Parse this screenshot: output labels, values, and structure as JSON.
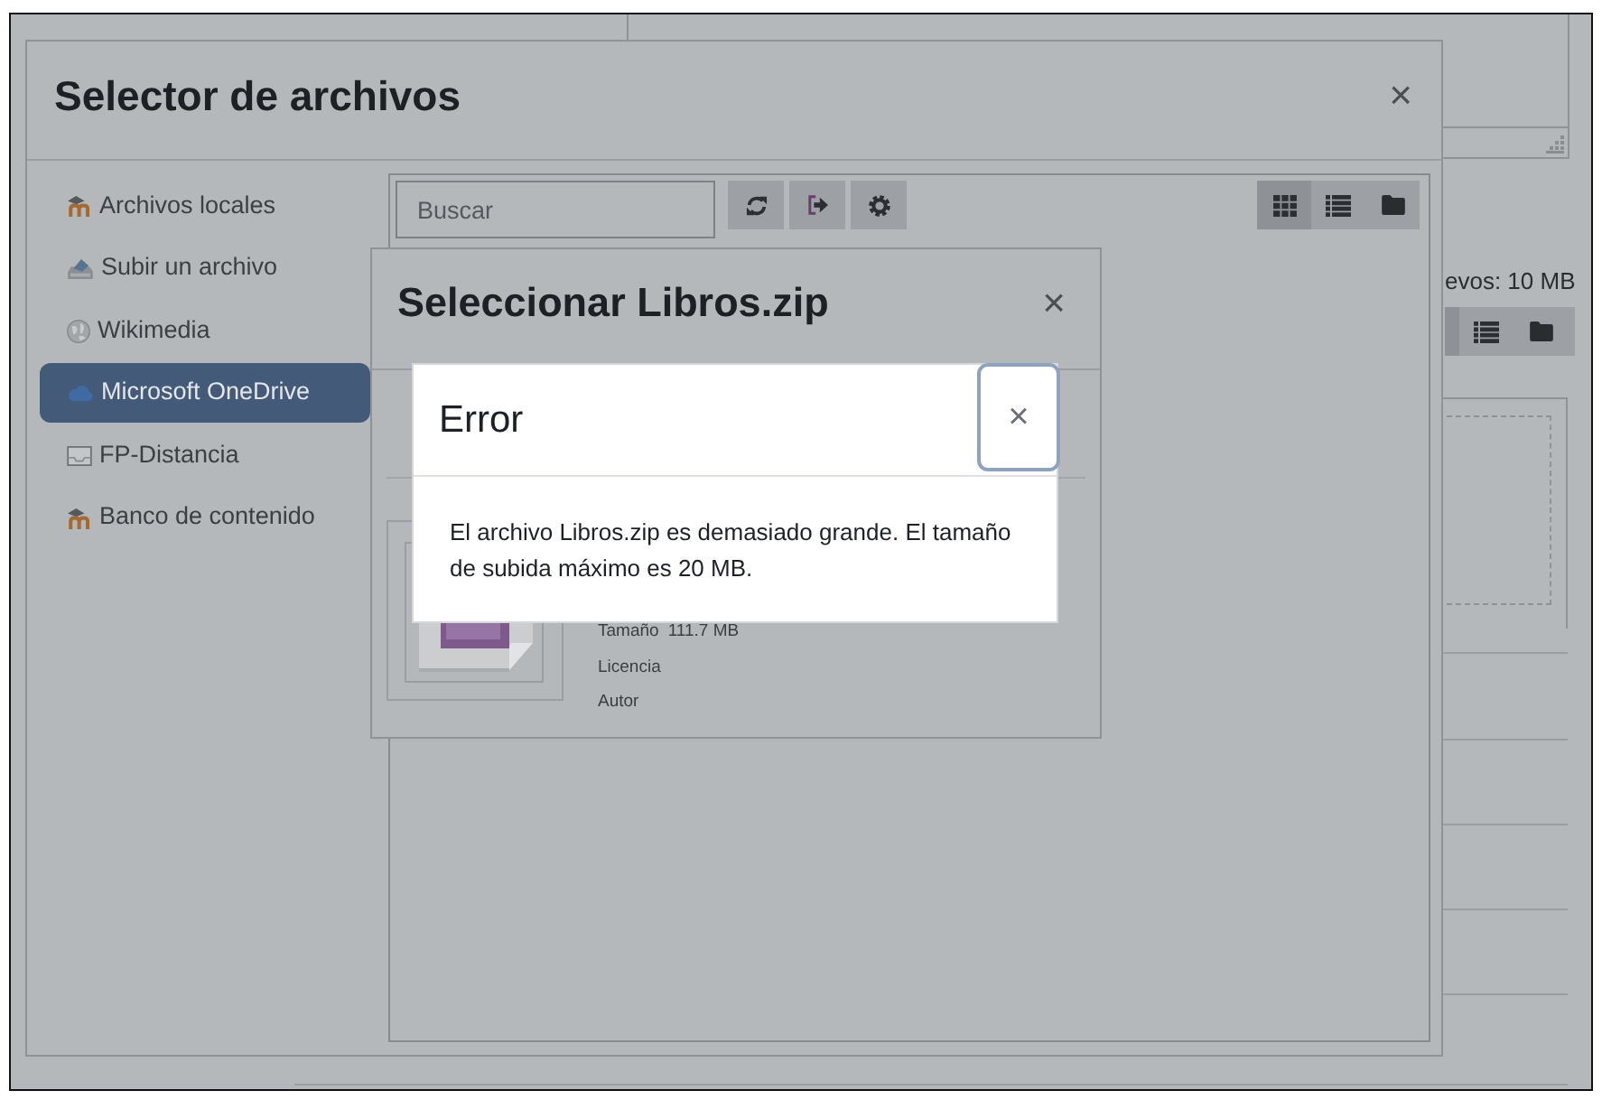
{
  "background_page": {
    "upload_limit": "evos: 10 MB"
  },
  "file_picker": {
    "title": "Selector de archivos",
    "close": "×",
    "repositories": [
      {
        "label": "Archivos locales",
        "kind": "hat",
        "selected": false
      },
      {
        "label": "Subir un archivo",
        "kind": "upload",
        "selected": false
      },
      {
        "label": "Wikimedia",
        "kind": "globe",
        "selected": false
      },
      {
        "label": "Microsoft OneDrive",
        "kind": "cloud",
        "selected": true
      },
      {
        "label": "FP-Distancia",
        "kind": "tray",
        "selected": false
      },
      {
        "label": "Banco de contenido",
        "kind": "hat",
        "selected": false
      }
    ],
    "search": {
      "placeholder": "Buscar"
    },
    "actions": [
      {
        "kind": "refresh"
      },
      {
        "kind": "logout"
      },
      {
        "kind": "settings"
      }
    ],
    "view_modes": [
      {
        "kind": "grid",
        "selected": true
      },
      {
        "kind": "list",
        "selected": false
      },
      {
        "kind": "folder",
        "selected": false
      }
    ]
  },
  "file_dialog": {
    "title": "Seleccionar Libros.zip",
    "close": "×",
    "details": [
      {
        "label": "Tamaño",
        "value": "111.7 MB"
      },
      {
        "label": "Licencia"
      },
      {
        "label": "Autor"
      }
    ]
  },
  "error_dialog": {
    "title": "Error",
    "close": "×",
    "close_focused": true,
    "message": "El archivo Libros.zip es demasiado grande. El tamaño de subida máximo es 20 MB."
  }
}
